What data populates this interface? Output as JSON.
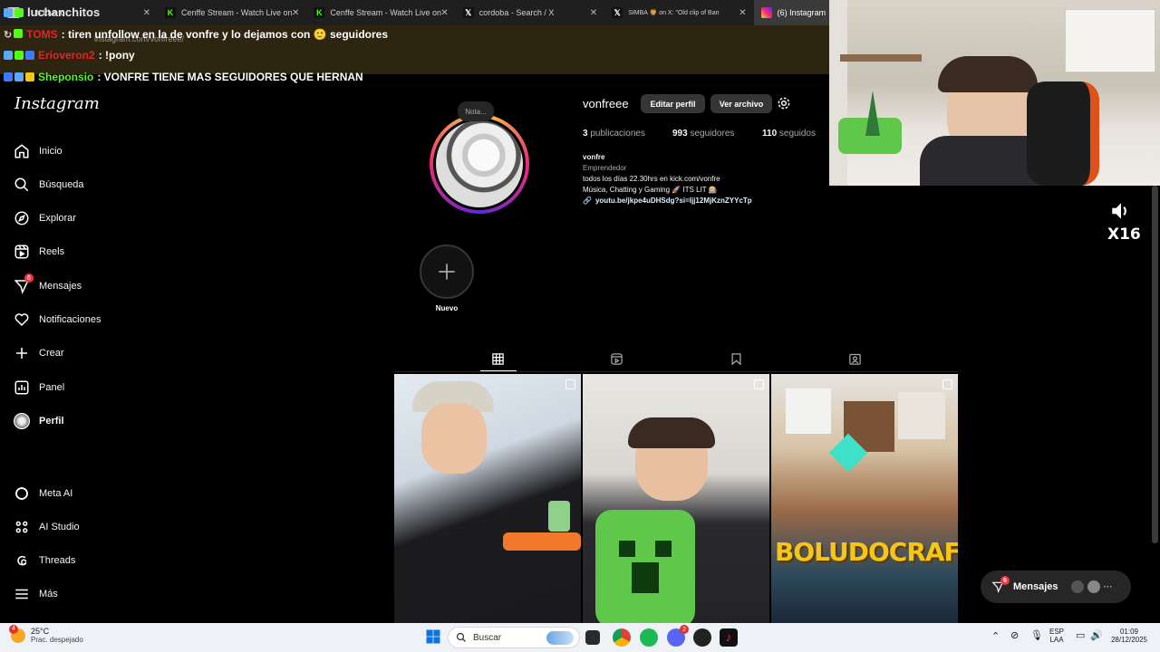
{
  "browser": {
    "tabs": [
      {
        "label": "h Live o",
        "active": false
      },
      {
        "label": "Cenffe Stream - Watch Live on",
        "active": false
      },
      {
        "label": "Cenffe Stream - Watch Live on",
        "active": false
      },
      {
        "label": "cordoba - Search / X",
        "active": false
      },
      {
        "label": "SIMBA 🦁 on X: \"Old clip of Ban",
        "active": false
      },
      {
        "label": "(6) Instagram",
        "active": true
      }
    ],
    "url": "instagram.com/vonfreee/"
  },
  "chat": {
    "lines": [
      {
        "user": "luchanchitos",
        "message": "",
        "user_color": "#e8e8e8"
      },
      {
        "user": "TOMS",
        "message": ": tiren unfollow en la de vonfre y lo dejamos con 🙂 seguidores",
        "user_color": "#e0242a"
      },
      {
        "user": "Erioveron2",
        "message": ": !pony",
        "user_color": "#e0242a"
      },
      {
        "user": "Sheponsio",
        "message": ": VONFRE TIENE MAS SEGUIDORES QUE HERNAN",
        "user_color": "#53fc18"
      }
    ]
  },
  "instagram": {
    "logo": "Instagram",
    "nav": [
      {
        "label": "Inicio",
        "icon": "home-icon"
      },
      {
        "label": "Búsqueda",
        "icon": "search-icon"
      },
      {
        "label": "Explorar",
        "icon": "compass-icon"
      },
      {
        "label": "Reels",
        "icon": "reels-icon"
      },
      {
        "label": "Mensajes",
        "icon": "messenger-icon",
        "badge": "6"
      },
      {
        "label": "Notificaciones",
        "icon": "heart-icon"
      },
      {
        "label": "Crear",
        "icon": "plus-icon"
      },
      {
        "label": "Panel",
        "icon": "chart-icon"
      },
      {
        "label": "Perfil",
        "icon": "profile-avatar-icon"
      }
    ],
    "nav_bottom": [
      {
        "label": "Meta AI",
        "icon": "meta-ai-icon"
      },
      {
        "label": "AI Studio",
        "icon": "ai-studio-icon"
      },
      {
        "label": "Threads",
        "icon": "threads-icon"
      },
      {
        "label": "Más",
        "icon": "menu-icon"
      }
    ],
    "profile": {
      "note_placeholder": "Nota...",
      "username": "vonfreee",
      "edit_button": "Editar perfil",
      "archive_button": "Ver archivo",
      "posts_count": "3",
      "posts_label": "publicaciones",
      "followers_count": "993",
      "followers_label": "seguidores",
      "following_count": "110",
      "following_label": "seguidos",
      "display_name": "vonfre",
      "category": "Emprendedor",
      "bio_line1": "todos los días 22.30hrs en kick.com/vonfre",
      "bio_line2": "Música, Chatting y Gaming 🚀 ITS LIT 🎰",
      "link": "youtu.be/jkpe4uDHSdg?si=ljj12MjKznZYYcTp"
    },
    "highlight_new": "Nuevo",
    "posts_tabs": [
      "grid-icon",
      "reels-tab-icon",
      "saved-icon",
      "tagged-icon"
    ],
    "posts": [
      {
        "alt": "birthday"
      },
      {
        "alt": "creeper plush"
      },
      {
        "alt": "BOLUDOCRAFT"
      }
    ],
    "post_overlay_text": "BOLUDOCRAFT",
    "messages_pill": {
      "label": "Mensajes",
      "badge": "6"
    }
  },
  "overlay": {
    "volume_label": "X16"
  },
  "taskbar": {
    "weather_temp": "25°C",
    "weather_desc": "Prac. despejado",
    "weather_badge": "4",
    "search_placeholder": "Buscar",
    "lang_top": "ESP",
    "lang_bottom": "LAA",
    "time": "01:09",
    "date": "28/12/2025",
    "discord_badge": "2"
  }
}
